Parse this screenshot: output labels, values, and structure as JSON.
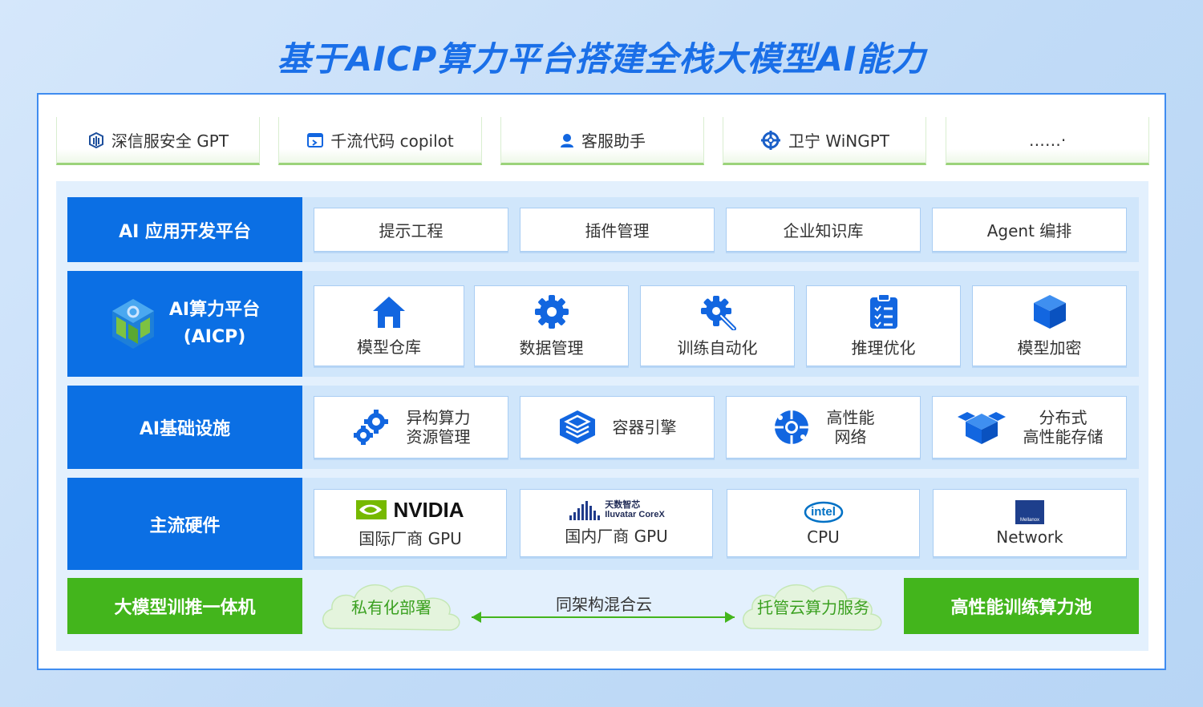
{
  "title": "基于AICP算力平台搭建全栈大模型AI能力",
  "apps": [
    {
      "label": "深信服安全 GPT",
      "icon": "sangfor-logo-icon"
    },
    {
      "label": "千流代码 copilot",
      "icon": "code-window-icon"
    },
    {
      "label": "客服助手",
      "icon": "user-support-icon"
    },
    {
      "label": "卫宁 WiNGPT",
      "icon": "winning-logo-icon"
    },
    {
      "label": "……·",
      "icon": ""
    }
  ],
  "layers": {
    "app_dev": {
      "label": "AI 应用开发平台",
      "items": [
        "提示工程",
        "插件管理",
        "企业知识库",
        "Agent 编排"
      ]
    },
    "aicp": {
      "label_line1": "AI算力平台",
      "label_line2": "(AICP)",
      "items": [
        {
          "label": "模型仓库",
          "icon": "house-icon"
        },
        {
          "label": "数据管理",
          "icon": "gear-icon"
        },
        {
          "label": "训练自动化",
          "icon": "gear-wrench-icon"
        },
        {
          "label": "推理优化",
          "icon": "clipboard-checklist-icon"
        },
        {
          "label": "模型加密",
          "icon": "cube-icon"
        }
      ]
    },
    "infra": {
      "label": "AI基础设施",
      "items": [
        {
          "line1": "异构算力",
          "line2": "资源管理",
          "icon": "gears-icon"
        },
        {
          "line1": "容器引擎",
          "line2": "",
          "icon": "layered-box-icon"
        },
        {
          "line1": "高性能",
          "line2": "网络",
          "icon": "network-sphere-icon"
        },
        {
          "line1": "分布式",
          "line2": "高性能存储",
          "icon": "storage-cubes-icon"
        }
      ]
    },
    "hardware": {
      "label": "主流硬件",
      "items": [
        {
          "logo": "NVIDIA",
          "label": "国际厂商 GPU"
        },
        {
          "logo_cn": "天数智芯",
          "logo_en": "Iluvatar CoreX",
          "label": "国内厂商 GPU"
        },
        {
          "logo": "intel",
          "label": "CPU"
        },
        {
          "logo": "Mellanox",
          "label": "Network"
        }
      ]
    }
  },
  "bottom": {
    "left_label": "大模型训推一体机",
    "right_label": "高性能训练算力池",
    "private_cloud": "私有化部署",
    "hybrid": "同架构混合云",
    "hosted_cloud": "托管云算力服务"
  },
  "colors": {
    "title_blue": "#1a6fe8",
    "layer_blue": "#0b6fe4",
    "icon_blue": "#1266e0",
    "green": "#43b51c"
  }
}
